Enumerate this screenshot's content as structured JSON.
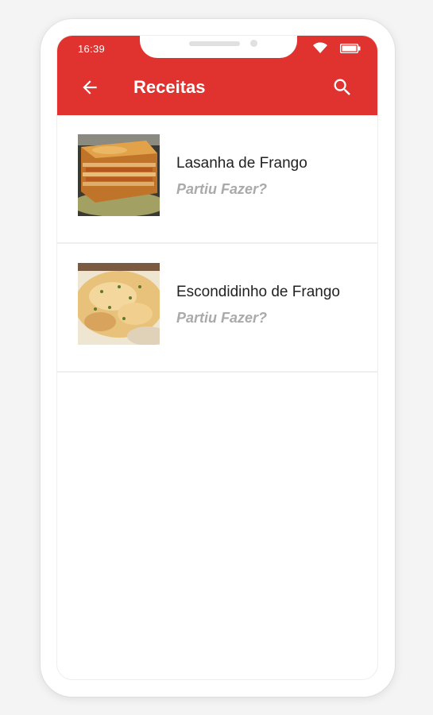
{
  "status_bar": {
    "time": "16:39"
  },
  "appbar": {
    "title": "Receitas",
    "back_icon": "arrow-left-icon",
    "search_icon": "search-icon"
  },
  "colors": {
    "primary": "#e0322f",
    "subtitle": "#aaaaaa"
  },
  "recipes": [
    {
      "title": "Lasanha de Frango",
      "subtitle": "Partiu Fazer?",
      "image": "lasagna-photo"
    },
    {
      "title": "Escondidinho de Frango",
      "subtitle": "Partiu Fazer?",
      "image": "escondidinho-photo"
    }
  ]
}
